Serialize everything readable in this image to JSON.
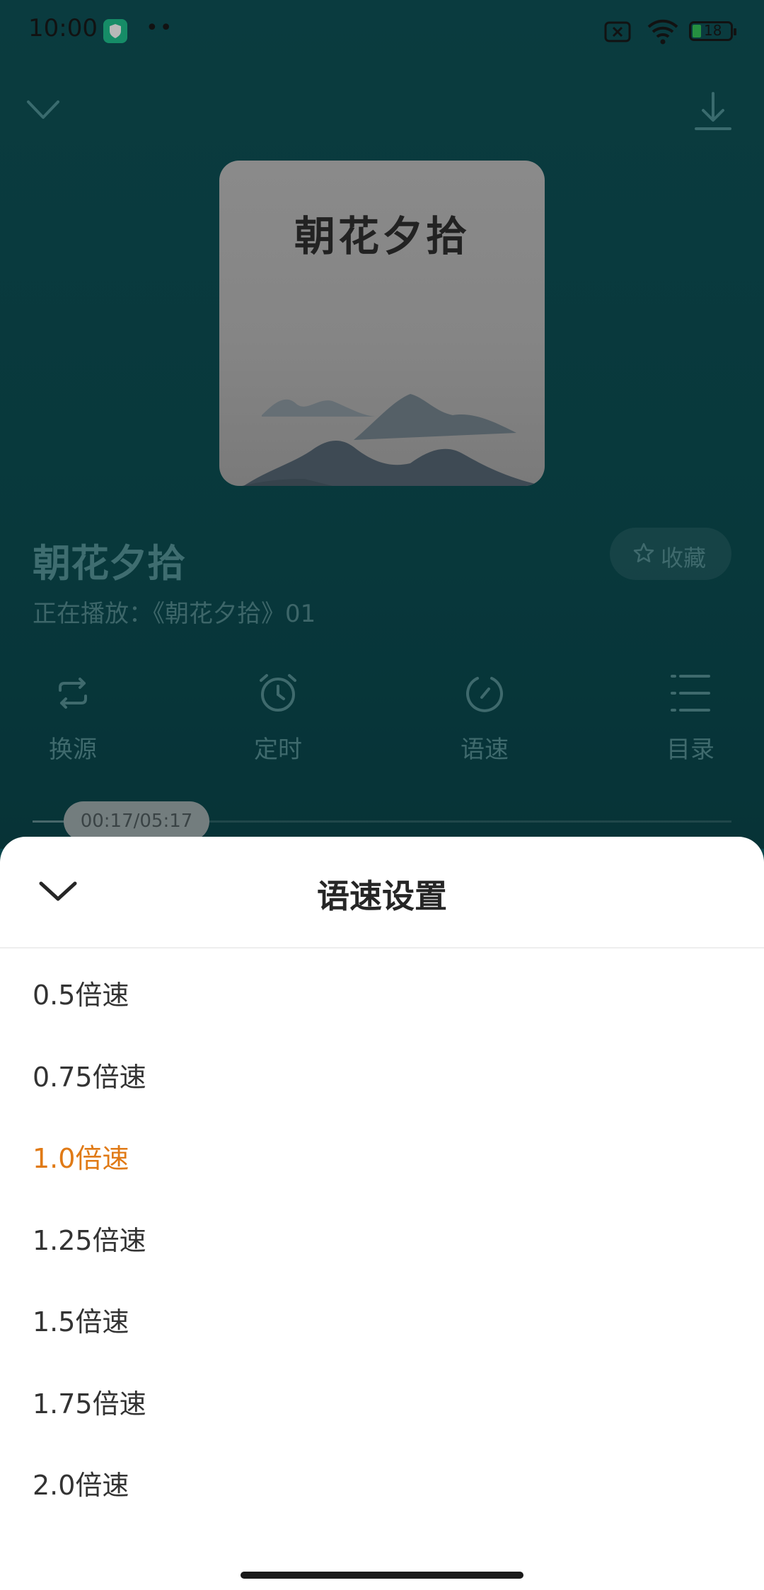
{
  "status_bar": {
    "time": "10:00",
    "dots": "••",
    "battery": "18"
  },
  "cover": {
    "title": "朝花夕拾"
  },
  "book": {
    "title": "朝花夕拾",
    "now_playing": "正在播放：《朝花夕拾》01"
  },
  "favorite": {
    "label": "收藏"
  },
  "controls": [
    {
      "label": "换源",
      "icon": "repeat-icon"
    },
    {
      "label": "定时",
      "icon": "alarm-clock-icon"
    },
    {
      "label": "语速",
      "icon": "speed-dial-icon"
    },
    {
      "label": "目录",
      "icon": "list-icon"
    }
  ],
  "progress": {
    "time": "00:17/05:17",
    "fraction": 0.054
  },
  "sheet": {
    "title": "语速设置",
    "options": [
      "0.5倍速",
      "0.75倍速",
      "1.0倍速",
      "1.25倍速",
      "1.5倍速",
      "1.75倍速",
      "2.0倍速"
    ],
    "selected": "1.0倍速"
  },
  "colors": {
    "accent": "#e07a16",
    "player_bg": "#0c4e53",
    "sheet_bg": "#ffffff"
  }
}
